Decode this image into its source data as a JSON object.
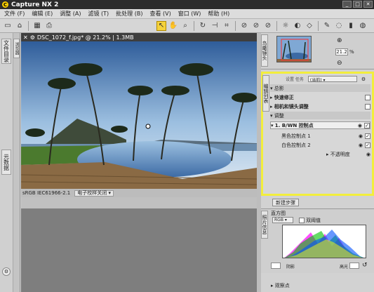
{
  "window": {
    "title": "Capture NX 2"
  },
  "menu": [
    "文件 (F)",
    "编辑 (E)",
    "调整 (A)",
    "滤镜 (T)",
    "批处理 (B)",
    "查看 (V)",
    "窗口 (W)",
    "帮助 (H)"
  ],
  "left_tabs": {
    "browser": "文件目录",
    "metadata": "元数据"
  },
  "left_side_tab": "浏览器",
  "document": {
    "tab_title": "DSC_1072_f.jpg* @ 21.2% | 1.3MB",
    "profile": "sRGB IEC61966-2.1",
    "proof": "电子校样关闭"
  },
  "navigator": {
    "tab": "鸟瞰镜头",
    "zoom": "21.2",
    "zoom_unit": "%"
  },
  "edit_list": {
    "tab": "编辑列表",
    "header": "设置 任务",
    "preset": "(当前)",
    "section_develop": "总影",
    "item_quick_fix": "快速修正",
    "item_camera_lens": "相机和镜头调整",
    "section_adjust": "调整",
    "step_title": "1. B/WN 控制点",
    "cp_black": "黑色控制点 1",
    "cp_white": "白色控制点 2",
    "opacity": "不透明度"
  },
  "new_step": "新建步骤",
  "histogram": {
    "tab": "照片信息",
    "title": "直方图",
    "channel": "RGB",
    "dual": "双阈值",
    "shadow_label": "阴影",
    "highlight_label": "高光"
  },
  "watch_points": "观察点"
}
